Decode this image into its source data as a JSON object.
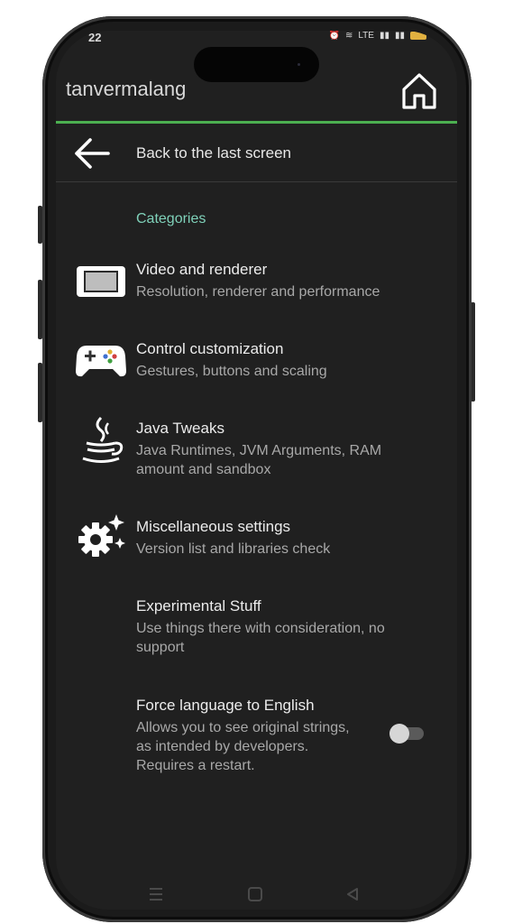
{
  "status_bar": {
    "time": "22",
    "network_label": "LTE",
    "battery_color": "#e0b040"
  },
  "app_bar": {
    "title": "tanvermalang",
    "home_icon": "home-icon",
    "accent_color": "#4caf50"
  },
  "back": {
    "label": "Back to the last screen",
    "icon": "arrow-left-icon"
  },
  "section": {
    "header": "Categories",
    "header_color": "#7fd1b9"
  },
  "items": [
    {
      "title": "Video and renderer",
      "subtitle": "Resolution, renderer and performance",
      "icon": "monitor-icon"
    },
    {
      "title": "Control customization",
      "subtitle": "Gestures, buttons and scaling",
      "icon": "gamepad-icon"
    },
    {
      "title": "Java Tweaks",
      "subtitle": "Java Runtimes, JVM Arguments, RAM amount and sandbox",
      "icon": "java-cup-icon"
    },
    {
      "title": "Miscellaneous settings",
      "subtitle": "Version list and libraries check",
      "icon": "gear-sparkle-icon"
    },
    {
      "title": "Experimental Stuff",
      "subtitle": "Use things there with consideration, no support",
      "icon": ""
    },
    {
      "title": "Force language to English",
      "subtitle": "Allows you to see original strings, as intended by developers. Requires a restart.",
      "icon": "",
      "toggle_on": false
    }
  ],
  "nav_bar": {
    "recents_icon": "recents-icon",
    "home_icon": "nav-home-icon",
    "back_icon": "nav-back-icon"
  }
}
